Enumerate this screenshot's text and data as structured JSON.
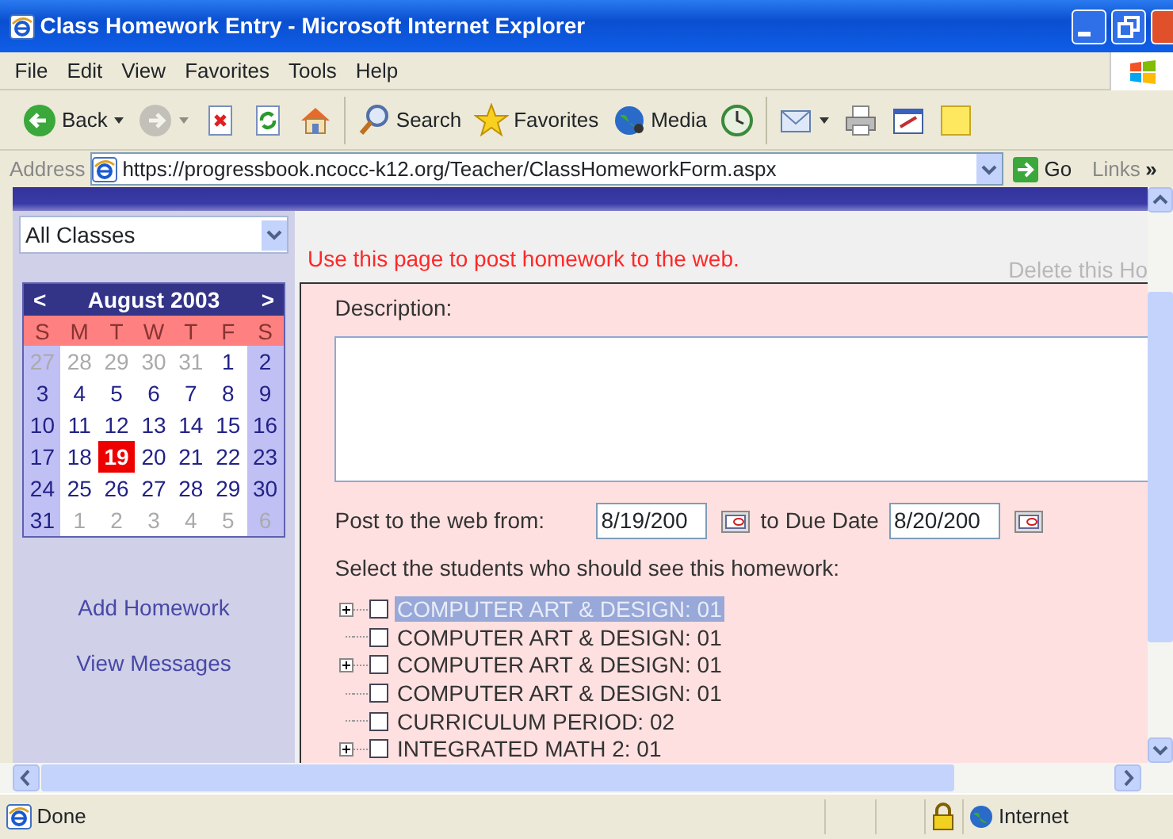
{
  "window": {
    "title": "Class Homework Entry - Microsoft Internet Explorer"
  },
  "menu": [
    "File",
    "Edit",
    "View",
    "Favorites",
    "Tools",
    "Help"
  ],
  "toolbar": [
    {
      "kind": "back",
      "label": "Back",
      "dropdown": true,
      "disabled": false
    },
    {
      "kind": "forward",
      "dropdown": true,
      "disabled": true
    },
    {
      "kind": "stop",
      "dropdown": false,
      "disabled": false
    },
    {
      "kind": "refresh",
      "dropdown": false,
      "disabled": false
    },
    {
      "kind": "home",
      "dropdown": false,
      "disabled": false
    },
    {
      "kind": "search",
      "label": "Search",
      "dropdown": false,
      "disabled": false
    },
    {
      "kind": "favorites",
      "label": "Favorites",
      "dropdown": false,
      "disabled": false
    },
    {
      "kind": "media",
      "label": "Media",
      "dropdown": false,
      "disabled": false
    },
    {
      "kind": "history",
      "dropdown": false,
      "disabled": false
    },
    {
      "kind": "mail",
      "dropdown": true,
      "disabled": false
    },
    {
      "kind": "print",
      "dropdown": false,
      "disabled": false
    },
    {
      "kind": "edit",
      "dropdown": false,
      "disabled": false
    },
    {
      "kind": "note",
      "dropdown": false,
      "disabled": false
    }
  ],
  "address": {
    "label": "Address",
    "url": "https://progressbook.ncocc-k12.org/Teacher/ClassHomeworkForm.aspx",
    "go": "Go",
    "links": "Links",
    "more": "»"
  },
  "sidebar": {
    "class_select": "All Classes",
    "calendar": {
      "prev": "<",
      "title": "August 2003",
      "next": ">",
      "weekdays": [
        "S",
        "M",
        "T",
        "W",
        "T",
        "F",
        "S"
      ],
      "weeks": [
        [
          {
            "day": "27",
            "other": true,
            "selected": false
          },
          {
            "day": "28",
            "other": true,
            "selected": false
          },
          {
            "day": "29",
            "other": true,
            "selected": false
          },
          {
            "day": "30",
            "other": true,
            "selected": false
          },
          {
            "day": "31",
            "other": true,
            "selected": false
          },
          {
            "day": "1",
            "other": false,
            "selected": false
          },
          {
            "day": "2",
            "other": false,
            "selected": false
          }
        ],
        [
          {
            "day": "3",
            "other": false,
            "selected": false
          },
          {
            "day": "4",
            "other": false,
            "selected": false
          },
          {
            "day": "5",
            "other": false,
            "selected": false
          },
          {
            "day": "6",
            "other": false,
            "selected": false
          },
          {
            "day": "7",
            "other": false,
            "selected": false
          },
          {
            "day": "8",
            "other": false,
            "selected": false
          },
          {
            "day": "9",
            "other": false,
            "selected": false
          }
        ],
        [
          {
            "day": "10",
            "other": false,
            "selected": false
          },
          {
            "day": "11",
            "other": false,
            "selected": false
          },
          {
            "day": "12",
            "other": false,
            "selected": false
          },
          {
            "day": "13",
            "other": false,
            "selected": false
          },
          {
            "day": "14",
            "other": false,
            "selected": false
          },
          {
            "day": "15",
            "other": false,
            "selected": false
          },
          {
            "day": "16",
            "other": false,
            "selected": false
          }
        ],
        [
          {
            "day": "17",
            "other": false,
            "selected": false
          },
          {
            "day": "18",
            "other": false,
            "selected": false
          },
          {
            "day": "19",
            "other": false,
            "selected": true
          },
          {
            "day": "20",
            "other": false,
            "selected": false
          },
          {
            "day": "21",
            "other": false,
            "selected": false
          },
          {
            "day": "22",
            "other": false,
            "selected": false
          },
          {
            "day": "23",
            "other": false,
            "selected": false
          }
        ],
        [
          {
            "day": "24",
            "other": false,
            "selected": false
          },
          {
            "day": "25",
            "other": false,
            "selected": false
          },
          {
            "day": "26",
            "other": false,
            "selected": false
          },
          {
            "day": "27",
            "other": false,
            "selected": false
          },
          {
            "day": "28",
            "other": false,
            "selected": false
          },
          {
            "day": "29",
            "other": false,
            "selected": false
          },
          {
            "day": "30",
            "other": false,
            "selected": false
          }
        ],
        [
          {
            "day": "31",
            "other": false,
            "selected": false
          },
          {
            "day": "1",
            "other": true,
            "selected": false
          },
          {
            "day": "2",
            "other": true,
            "selected": false
          },
          {
            "day": "3",
            "other": true,
            "selected": false
          },
          {
            "day": "4",
            "other": true,
            "selected": false
          },
          {
            "day": "5",
            "other": true,
            "selected": false
          },
          {
            "day": "6",
            "other": true,
            "selected": false
          }
        ]
      ]
    },
    "links": [
      "Add Homework",
      "View Messages"
    ]
  },
  "main": {
    "notice": "Use this page to post homework to the web.",
    "delete_link": "Delete this Ho",
    "description_label": "Description:",
    "from_label": "Post to the web from:",
    "from_value": "8/19/200",
    "to_label": "to Due Date",
    "to_value": "8/20/200",
    "students_label": "Select the students who should see this homework:",
    "tree": [
      {
        "label": "COMPUTER ART & DESIGN: 01",
        "expandable": true,
        "checked": false,
        "selected": true
      },
      {
        "label": "COMPUTER ART & DESIGN: 01",
        "expandable": false,
        "checked": false,
        "selected": false
      },
      {
        "label": "COMPUTER ART & DESIGN: 01",
        "expandable": true,
        "checked": false,
        "selected": false
      },
      {
        "label": "COMPUTER ART & DESIGN: 01",
        "expandable": false,
        "checked": false,
        "selected": false
      },
      {
        "label": "CURRICULUM PERIOD: 02",
        "expandable": false,
        "checked": false,
        "selected": false
      },
      {
        "label": "INTEGRATED MATH 2: 01",
        "expandable": true,
        "checked": false,
        "selected": false
      }
    ]
  },
  "status_bar": {
    "text": "Done",
    "zone": "Internet"
  }
}
